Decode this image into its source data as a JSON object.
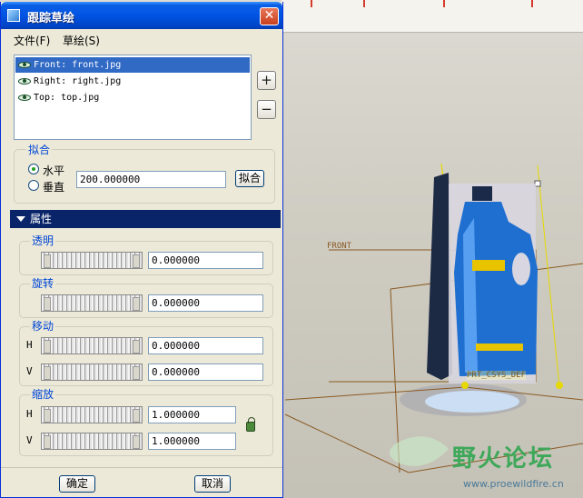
{
  "dialog": {
    "title": "跟踪草绘",
    "close_label": "✕"
  },
  "menu": {
    "file": "文件(F)",
    "sketch": "草绘(S)"
  },
  "images": [
    {
      "label": "Front: front.jpg",
      "selected": true
    },
    {
      "label": "Right: right.jpg",
      "selected": false
    },
    {
      "label": "Top: top.jpg",
      "selected": false
    }
  ],
  "side_buttons": {
    "add": "+",
    "remove": "−"
  },
  "fit": {
    "title": "拟合",
    "horizontal": "水平",
    "vertical": "垂直",
    "selected": "horizontal",
    "value": "200.000000",
    "button": "拟合"
  },
  "properties": {
    "header": "属性",
    "transparency": {
      "title": "透明",
      "value": "0.000000"
    },
    "rotation": {
      "title": "旋转",
      "value": "0.000000"
    },
    "move": {
      "title": "移动",
      "h_label": "H",
      "h_value": "0.000000",
      "v_label": "V",
      "v_value": "0.000000"
    },
    "scale": {
      "title": "缩放",
      "h_label": "H",
      "h_value": "1.000000",
      "v_label": "V",
      "v_value": "1.000000"
    }
  },
  "footer": {
    "ok": "确定",
    "cancel": "取消"
  },
  "viewport": {
    "front_plane_label": "FRONT",
    "csys_label": "PRT_CSYS_DEF",
    "watermark_text": "野火论坛",
    "watermark_url": "www.proewildfire.cn"
  },
  "colors": {
    "titlebar": "#0054e3",
    "selection": "#316ac5",
    "section_header": "#0a246a",
    "datum_plane": "#8a5a23",
    "datum_axis": "#e6d800",
    "bottle": "#1f6fd1"
  }
}
